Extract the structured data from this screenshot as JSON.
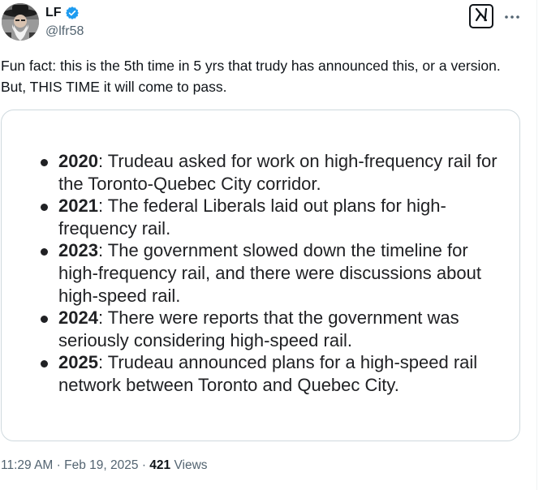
{
  "author": {
    "name": "LF",
    "handle": "@lfr58",
    "verified_color": "#1d9bf0"
  },
  "tweet": {
    "text": "Fun fact: this is the 5th time in 5 yrs that trudy has announced this, or a version. But, THIS TIME it will come to pass."
  },
  "media": {
    "items": [
      {
        "year": "2020",
        "text": ": Trudeau asked for work on high-frequency rail for the Toronto-Quebec City corridor."
      },
      {
        "year": "2021",
        "text": ": The federal Liberals laid out plans for high-frequency rail."
      },
      {
        "year": "2023",
        "text": ": The government slowed down the timeline for high-frequency rail, and there were discussions about high-speed rail."
      },
      {
        "year": "2024",
        "text": ": There were reports that the government was seriously considering high-speed rail."
      },
      {
        "year": "2025",
        "text": ": Trudeau announced plans for a high-speed rail network between Toronto and Quebec City."
      }
    ]
  },
  "meta": {
    "time": "11:29 AM",
    "separator": "·",
    "date": "Feb 19, 2025",
    "views_count": "421",
    "views_label": "Views"
  },
  "icons": {
    "grok": "grok-icon",
    "more": "more-icon",
    "verified": "verified-badge-icon"
  }
}
